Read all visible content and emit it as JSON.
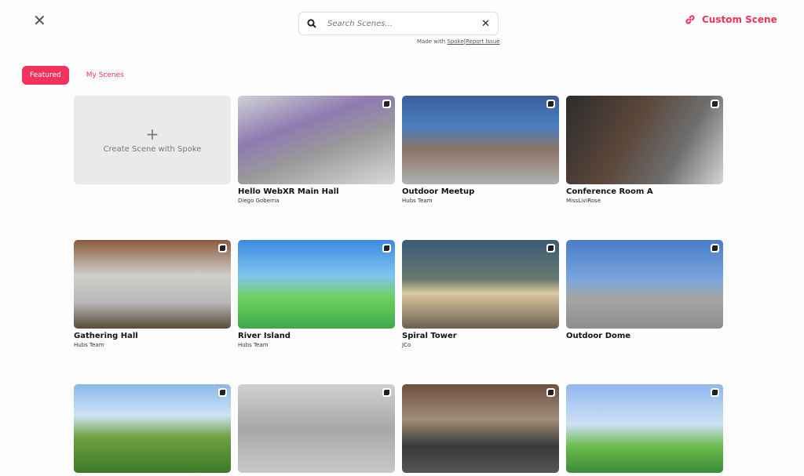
{
  "header": {
    "close_icon": "close-icon",
    "search_placeholder": "Search Scenes...",
    "made_with": "Made with",
    "spoke_link": "Spoke",
    "separator": "|",
    "report_link": "Report Issue",
    "custom_scene": "Custom Scene",
    "accent": "#f3325d"
  },
  "tabs": [
    {
      "label": "Featured",
      "active": true
    },
    {
      "label": "My Scenes",
      "active": false
    }
  ],
  "create_label": "Create Scene with Spoke",
  "scenes": [
    {
      "title": "Hello WebXR Main Hall",
      "author": "Diego Goberna",
      "bg": "linear-gradient(160deg,#cfd3d6 0%,#8e7ab0 35%,#9a9a9a 60%,#dadada 100%)"
    },
    {
      "title": "Outdoor Meetup",
      "author": "Hubs Team",
      "bg": "linear-gradient(180deg,#3b5f9c 0%,#4a7fc0 35%,#8a7468 60%,#b0b0b0 100%)"
    },
    {
      "title": "Conference Room A",
      "author": "MissLiviRose",
      "bg": "linear-gradient(120deg,#2c2c2c 0%,#5b463a 40%,#6e6e6e 70%,#d5d5d5 100%)"
    },
    {
      "title": "Gathering Hall",
      "author": "Hubs Team",
      "bg": "linear-gradient(180deg,#8a5a3c 0%,#d0cfcc 40%,#b8b8b8 70%,#5a4a3a 100%)"
    },
    {
      "title": "River Island",
      "author": "Hubs Team",
      "bg": "linear-gradient(180deg,#3a8ae0 0%,#7fc4f0 40%,#6fd060 65%,#3fa848 100%)"
    },
    {
      "title": "Spiral Tower",
      "author": "JCo",
      "bg": "linear-gradient(180deg,#3a5c76 0%,#6b7a70 45%,#d9c9a0 60%,#6d6050 100%)"
    },
    {
      "title": "Outdoor Dome",
      "author": "",
      "bg": "linear-gradient(180deg,#4a7cc8 0%,#7aa6dc 45%,#a5a5a5 65%,#8e8e8e 100%)"
    },
    {
      "title": "",
      "author": "",
      "bg": "linear-gradient(180deg,#8ab8e8 0%,#cfe2f4 35%,#6da040 60%,#3e7a28 100%)"
    },
    {
      "title": "",
      "author": "",
      "bg": "linear-gradient(180deg,#d0d0d0 0%,#a8a8a8 50%,#c8c8c8 100%)"
    },
    {
      "title": "",
      "author": "",
      "bg": "linear-gradient(180deg,#6e5040 0%,#a08c78 40%,#3a3a3a 70%,#555 100%)"
    },
    {
      "title": "",
      "author": "",
      "bg": "linear-gradient(180deg,#8fb8ec 0%,#cde0f5 45%,#6bbd4c 70%,#3d8c3a 100%)"
    }
  ]
}
